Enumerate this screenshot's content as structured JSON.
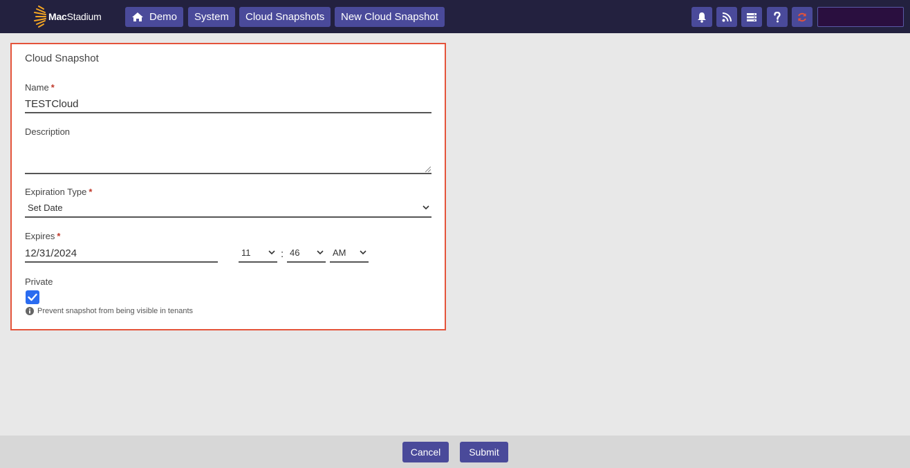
{
  "header": {
    "brand_prefix": "Mac",
    "brand_suffix": "Stadium",
    "breadcrumbs": [
      {
        "label": "Demo",
        "icon": "home-icon"
      },
      {
        "label": "System"
      },
      {
        "label": "Cloud Snapshots"
      },
      {
        "label": "New Cloud Snapshot"
      }
    ],
    "icons": [
      "bell-icon",
      "rss-icon",
      "server-list-icon",
      "question-icon",
      "refresh-icon"
    ],
    "accent_color": "#4a4a9a",
    "refresh_color": "#e4533a"
  },
  "form": {
    "title": "Cloud Snapshot",
    "name": {
      "label": "Name",
      "required_mark": "*",
      "value": "TESTCloud"
    },
    "description": {
      "label": "Description",
      "value": ""
    },
    "expiration_type": {
      "label": "Expiration Type",
      "required_mark": "*",
      "value": "Set Date"
    },
    "expires": {
      "label": "Expires",
      "required_mark": "*",
      "date": "12/31/2024",
      "hour": "11",
      "separator": ":",
      "minute": "46",
      "ampm": "AM"
    },
    "private": {
      "label": "Private",
      "checked": true,
      "hint": "Prevent snapshot from being visible in tenants"
    }
  },
  "footer": {
    "cancel_label": "Cancel",
    "submit_label": "Submit"
  }
}
